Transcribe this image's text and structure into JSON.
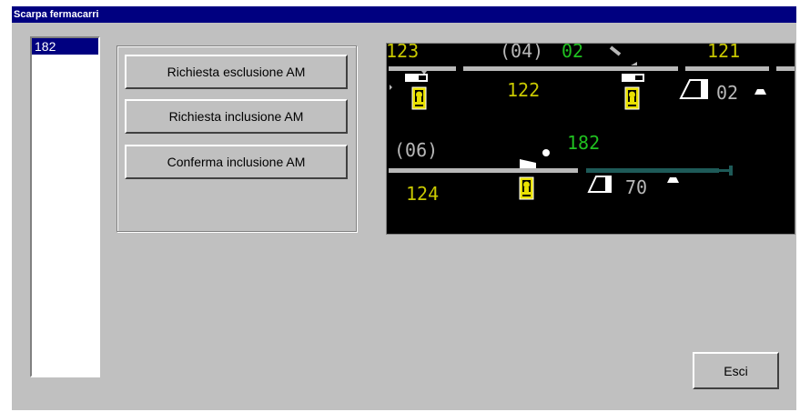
{
  "window": {
    "title": "Scarpa fermacarri"
  },
  "list": {
    "items": [
      {
        "label": "182",
        "selected": true
      }
    ]
  },
  "buttons": {
    "request_exclusion": "Richiesta esclusione AM",
    "request_inclusion": "Richiesta inclusione AM",
    "confirm_inclusion": "Conferma inclusione AM",
    "exit": "Esci"
  },
  "diagram": {
    "track_labels": {
      "t123": "123",
      "t04": "(04)",
      "t02a": "02",
      "t121": "121",
      "t122": "122",
      "t02b": "02",
      "t06": "(06)",
      "t182": "182",
      "t124": "124",
      "t70": "70"
    },
    "colors": {
      "yellow": "#c8c800",
      "green": "#20c020",
      "gray": "#b8b8b8",
      "teal": "#1e5a58",
      "signal_yellow": "#e8e000"
    }
  }
}
